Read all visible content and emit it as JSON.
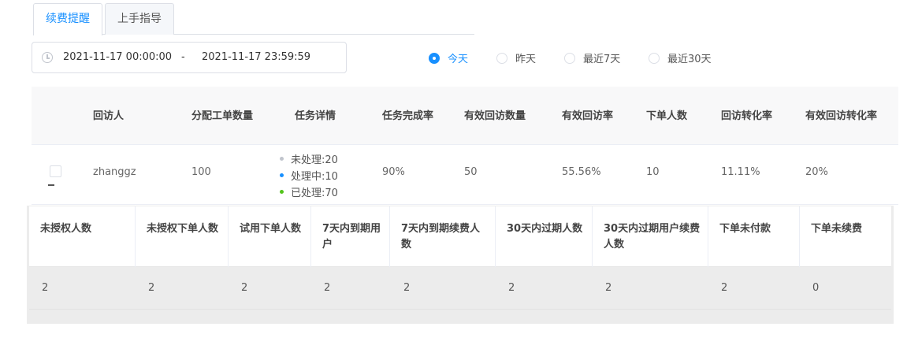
{
  "tabs": [
    {
      "label": "续费提醒",
      "active": true
    },
    {
      "label": "上手指导",
      "active": false
    }
  ],
  "date_range": {
    "start": "2021-11-17 00:00:00",
    "separator": "-",
    "end": "2021-11-17 23:59:59"
  },
  "quick_ranges": [
    {
      "label": "今天",
      "checked": true
    },
    {
      "label": "昨天",
      "checked": false
    },
    {
      "label": "最近7天",
      "checked": false
    },
    {
      "label": "最近30天",
      "checked": false
    }
  ],
  "main_table": {
    "headers": [
      "回访人",
      "分配工单数量",
      "任务详情",
      "任务完成率",
      "有效回访数量",
      "有效回访率",
      "下单人数",
      "回访转化率",
      "有效回访转化率"
    ],
    "rows": [
      {
        "visitor": "zhanggz",
        "assigned": "100",
        "tasks": [
          {
            "label": "未处理:20",
            "color": "#c0c4cc"
          },
          {
            "label": "处理中:10",
            "color": "#1890ff"
          },
          {
            "label": "已处理:70",
            "color": "#52c41a"
          }
        ],
        "completion_rate": "90%",
        "valid_visits": "50",
        "valid_rate": "55.56%",
        "orders": "10",
        "conversion_rate": "11.11%",
        "valid_conversion_rate": "20%"
      }
    ]
  },
  "sub_table": {
    "headers": [
      "未授权人数",
      "未授权下单人数",
      "试用下单人数",
      "7天内到期用户",
      "7天内到期续费人数",
      "30天内过期人数",
      "30天内过期用户续费人数",
      "下单未付款",
      "下单未续费"
    ],
    "values": [
      "2",
      "2",
      "2",
      "2",
      "2",
      "2",
      "2",
      "2",
      "0"
    ]
  }
}
